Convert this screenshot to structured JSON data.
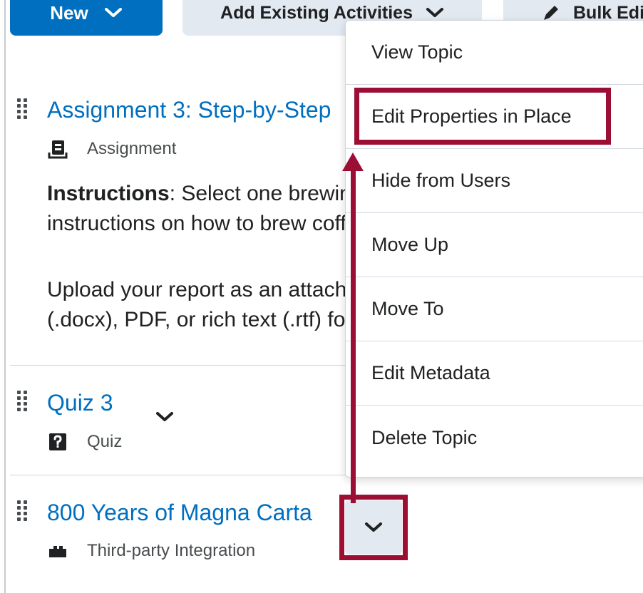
{
  "toolbar": {
    "new_label": "New",
    "add_existing_label": "Add Existing Activities",
    "bulk_edit_label": "Bulk Edit"
  },
  "items": [
    {
      "title": "Assignment 3: Step-by-Step",
      "type": "Assignment",
      "icon": "assignment-icon",
      "instructions_label": "Instructions",
      "instructions_line1": ": Select one brewing method and write step-by-step",
      "instructions_line2": "instructions on how to brew coffee using that method.",
      "upload_line1": "Upload your report as an attachment in Word",
      "upload_line2": "(.docx), PDF, or rich text (.rtf) format."
    },
    {
      "title": "Quiz 3",
      "type": "Quiz",
      "icon": "quiz-icon"
    },
    {
      "title": "800 Years of Magna Carta",
      "type": "Third-party Integration",
      "icon": "lti-integration-icon"
    }
  ],
  "menu": {
    "items": [
      "View Topic",
      "Edit Properties in Place",
      "Hide from Users",
      "Move Up",
      "Move To",
      "Edit Metadata",
      "Delete Topic"
    ],
    "highlighted": "Edit Properties in Place"
  },
  "colors": {
    "primary": "#006fbf",
    "annotation": "#9d0e35",
    "secondary_button": "#e3e9f1"
  }
}
